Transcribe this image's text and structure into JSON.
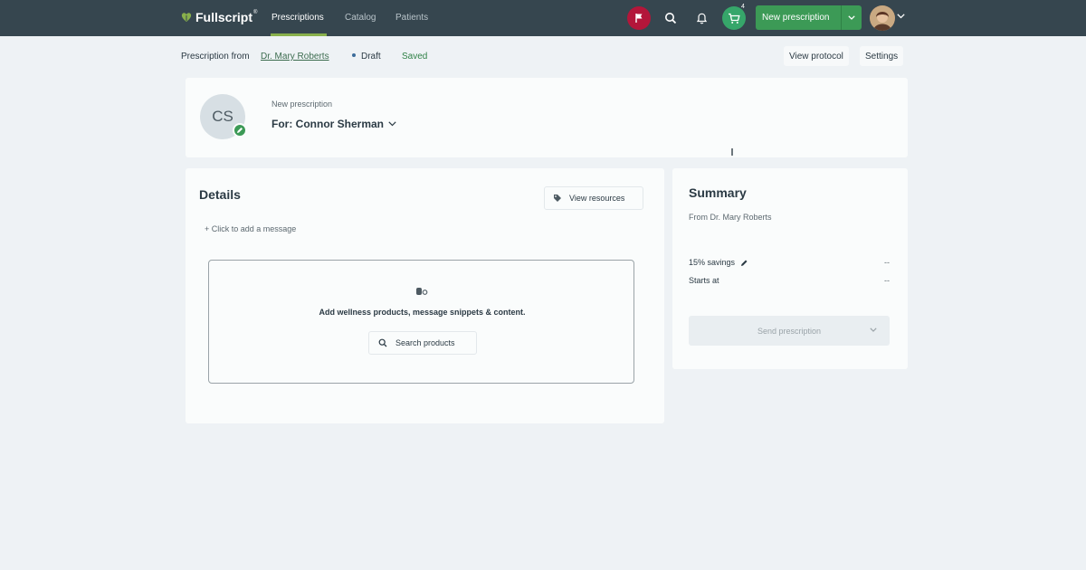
{
  "nav": {
    "brand": "Fullscript",
    "brand_tm": "®",
    "links": [
      "Prescriptions",
      "Catalog",
      "Patients"
    ],
    "cart_count": "4",
    "new_prescription_label": "New prescription"
  },
  "subheader": {
    "prefix": "Prescription from",
    "doctor_link": "Dr. Mary Roberts",
    "status": "Draft",
    "saved": "Saved",
    "view_protocol": "View protocol",
    "settings": "Settings"
  },
  "patient": {
    "initials": "CS",
    "new_label": "New prescription",
    "for_label": "For: Connor Sherman"
  },
  "details": {
    "title": "Details",
    "view_resources": "View resources",
    "add_message": "+ Click to add a message",
    "dropzone_text": "Add wellness products, message snippets & content.",
    "search_products": "Search products"
  },
  "summary": {
    "title": "Summary",
    "from": "From Dr. Mary Roberts",
    "savings_label": "15% savings",
    "savings_value": "--",
    "starts_label": "Starts at",
    "starts_value": "--",
    "send_label": "Send prescription"
  },
  "colors": {
    "nav_bg": "#36464f",
    "accent_green": "#3c9a56",
    "flag_red": "#b3163a",
    "page_bg": "#eef2f5"
  }
}
